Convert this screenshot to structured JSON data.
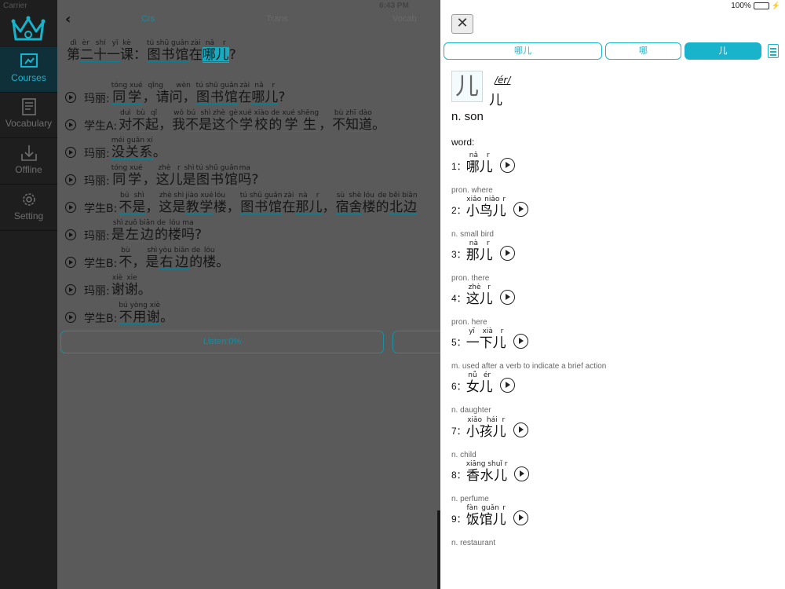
{
  "status_bar": {
    "carrier": "Carrier",
    "time": "6:43 PM",
    "battery": "100%"
  },
  "sidebar": {
    "items": [
      {
        "label": "Courses",
        "icon": "courses-icon",
        "active": true
      },
      {
        "label": "Vocabulary",
        "icon": "vocabulary-icon"
      },
      {
        "label": "Offline",
        "icon": "download-icon"
      },
      {
        "label": "Setting",
        "icon": "gear-icon"
      }
    ]
  },
  "main": {
    "tabs": [
      "Crs",
      "Trans",
      "Vocab"
    ],
    "title": [
      {
        "hz": "第",
        "py": "dì"
      },
      {
        "hz": "二十一",
        "py": "èr shí yī",
        "u": true
      },
      {
        "hz": "课",
        "py": "kè"
      },
      {
        "hz": "：",
        "py": ""
      },
      {
        "hz": "图书馆",
        "py": "tú shū guǎn",
        "u": true
      },
      {
        "hz": "在",
        "py": "zài"
      },
      {
        "hz": "哪儿",
        "py": "nǎ r",
        "u": true,
        "hl": true
      },
      {
        "hz": "?",
        "py": ""
      }
    ],
    "lines": [
      {
        "speaker": "玛丽:",
        "segs": [
          {
            "hz": "同学",
            "py": "tóng xué",
            "u": true
          },
          {
            "hz": "，请问，",
            "py": "qǐng wèn"
          },
          {
            "hz": "图书馆",
            "py": "tú shū guǎn",
            "u": true
          },
          {
            "hz": "在",
            "py": "zài"
          },
          {
            "hz": "哪儿",
            "py": "nǎ r",
            "u": true
          },
          {
            "hz": "?",
            "py": ""
          }
        ]
      },
      {
        "speaker": "学生A:",
        "segs": [
          {
            "hz": "对不起",
            "py": "duì bù qǐ",
            "u": true
          },
          {
            "hz": "，",
            "py": ""
          },
          {
            "hz": "我",
            "py": "wǒ"
          },
          {
            "hz": "不是",
            "py": "bú shì",
            "u": true
          },
          {
            "hz": "这个",
            "py": "zhè gè",
            "u": true
          },
          {
            "hz": "学校",
            "py": "xué xiào",
            "u": true
          },
          {
            "hz": "的",
            "py": "de"
          },
          {
            "hz": "学生",
            "py": "xué shēng",
            "u": true
          },
          {
            "hz": "，",
            "py": ""
          },
          {
            "hz": "不",
            "py": "bù"
          },
          {
            "hz": "知道",
            "py": "zhī dào",
            "u": true
          },
          {
            "hz": "。",
            "py": ""
          }
        ]
      },
      {
        "speaker": "玛丽:",
        "segs": [
          {
            "hz": "没关系",
            "py": "méi guān xi",
            "u": true
          },
          {
            "hz": "。",
            "py": ""
          }
        ]
      },
      {
        "speaker": "玛丽:",
        "segs": [
          {
            "hz": "同学",
            "py": "tóng xué",
            "u": true
          },
          {
            "hz": "，",
            "py": ""
          },
          {
            "hz": "这儿",
            "py": "zhè r",
            "u": true
          },
          {
            "hz": "是",
            "py": "shì"
          },
          {
            "hz": "图书馆",
            "py": "tú shū guǎn",
            "u": true
          },
          {
            "hz": "吗",
            "py": "ma"
          },
          {
            "hz": "?",
            "py": ""
          }
        ]
      },
      {
        "speaker": "学生B:",
        "segs": [
          {
            "hz": "不是",
            "py": "bú shì",
            "u": true
          },
          {
            "hz": "，",
            "py": ""
          },
          {
            "hz": "这",
            "py": "zhè"
          },
          {
            "hz": "是",
            "py": "shì"
          },
          {
            "hz": "教学",
            "py": "jiào xué",
            "u": true
          },
          {
            "hz": "楼",
            "py": "lóu"
          },
          {
            "hz": "，",
            "py": ""
          },
          {
            "hz": "图书馆",
            "py": "tú shū guǎn",
            "u": true
          },
          {
            "hz": "在",
            "py": "zài"
          },
          {
            "hz": "那儿",
            "py": "nà r",
            "u": true
          },
          {
            "hz": "，",
            "py": ""
          },
          {
            "hz": "宿舍",
            "py": "sù shè",
            "u": true
          },
          {
            "hz": "楼",
            "py": "lóu"
          },
          {
            "hz": "的",
            "py": "de"
          },
          {
            "hz": "北边",
            "py": "běi biān",
            "u": true
          }
        ]
      },
      {
        "speaker": "玛丽:",
        "segs": [
          {
            "hz": "是",
            "py": "shì"
          },
          {
            "hz": "左边",
            "py": "zuǒ biān",
            "u": true
          },
          {
            "hz": "的",
            "py": "de"
          },
          {
            "hz": "楼",
            "py": "lóu"
          },
          {
            "hz": "吗",
            "py": "ma"
          },
          {
            "hz": "?",
            "py": ""
          }
        ]
      },
      {
        "speaker": "学生B:",
        "segs": [
          {
            "hz": "不",
            "py": "bù"
          },
          {
            "hz": "，",
            "py": ""
          },
          {
            "hz": "是",
            "py": "shì"
          },
          {
            "hz": "右边",
            "py": "yòu biān",
            "u": true
          },
          {
            "hz": "的",
            "py": "de"
          },
          {
            "hz": "楼",
            "py": "lóu"
          },
          {
            "hz": "。",
            "py": ""
          }
        ]
      },
      {
        "speaker": "玛丽:",
        "segs": [
          {
            "hz": "谢谢",
            "py": "xiè xie",
            "u": true
          },
          {
            "hz": "。",
            "py": ""
          }
        ]
      },
      {
        "speaker": "学生B:",
        "segs": [
          {
            "hz": "不用谢",
            "py": "bú yòng xiè",
            "u": true
          },
          {
            "hz": "。",
            "py": ""
          }
        ]
      }
    ],
    "listen_label": "Listen:0%"
  },
  "panel": {
    "close_label": "✕",
    "segments": [
      "哪儿",
      "哪",
      "儿"
    ],
    "char": "儿",
    "char_pinyin": "/ér/",
    "char_small": "儿",
    "definition": "n.  son",
    "word_label": "word:",
    "words": [
      {
        "num": "1：",
        "hz": "哪儿",
        "py": "nǎ r",
        "def": "pron.  where"
      },
      {
        "num": "2：",
        "hz": "小鸟儿",
        "py": "xiǎo niǎo r",
        "def": "n.  small bird"
      },
      {
        "num": "3：",
        "hz": "那儿",
        "py": "nà r",
        "def": "pron.  there"
      },
      {
        "num": "4：",
        "hz": "这儿",
        "py": "zhè r",
        "def": "pron.  here"
      },
      {
        "num": "5：",
        "hz": "一下儿",
        "py": "yī xià r",
        "def": "m.  used after a verb to indicate a brief action"
      },
      {
        "num": "6：",
        "hz": "女儿",
        "py": "nǚ ér",
        "def": "n.  daughter"
      },
      {
        "num": "7：",
        "hz": "小孩儿",
        "py": "xiǎo hái r",
        "def": "n.  child"
      },
      {
        "num": "8：",
        "hz": "香水儿",
        "py": "xiāng shuǐ r",
        "def": "n.  perfume"
      },
      {
        "num": "9：",
        "hz": "饭馆儿",
        "py": "fàn guǎn r",
        "def": "n.  restaurant"
      }
    ]
  },
  "colors": {
    "accent": "#19b3cb",
    "sidebar": "#1e1e1e",
    "dim_main": "#5a5a5a"
  }
}
